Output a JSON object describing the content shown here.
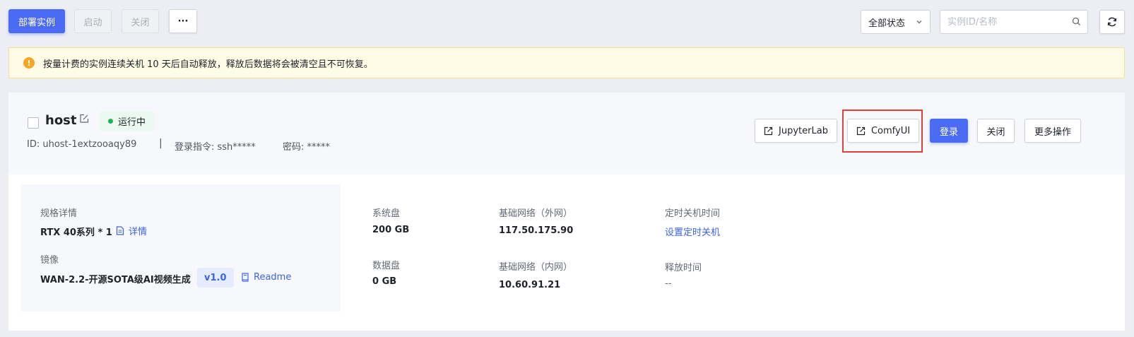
{
  "toolbar": {
    "deploy_label": "部署实例",
    "start_label": "启动",
    "close_label": "关闭",
    "more_label": "···",
    "status_filter": "全部状态",
    "search_placeholder": "实例ID/名称"
  },
  "notice": {
    "text": "按量计费的实例连续关机 10 天后自动释放，释放后数据将会被清空且不可恢复。"
  },
  "instance": {
    "name": "host",
    "status": "运行中",
    "id_text": "ID: uhost-1extzooaqy89",
    "separator": "|",
    "login_cmd": "登录指令: ssh*****",
    "password": "密码: *****",
    "actions": {
      "jupyter": "JupyterLab",
      "comfy": "ComfyUI",
      "login": "登录",
      "close": "关闭",
      "more": "更多操作"
    },
    "spec": {
      "spec_label": "规格详情",
      "spec_value": "RTX 40系列 * 1",
      "detail_link": "详情",
      "image_label": "镜像",
      "image_value": "WAN-2.2-开源SOTA级AI视频生成",
      "image_version": "v1.0",
      "readme_link": "Readme"
    },
    "disks": {
      "system_label": "系统盘",
      "system_value": "200 GB",
      "data_label": "数据盘",
      "data_value": "0 GB"
    },
    "network": {
      "public_label": "基础网络（外网）",
      "public_value": "117.50.175.90",
      "private_label": "基础网络（内网）",
      "private_value": "10.60.91.21"
    },
    "schedule": {
      "shutdown_label": "定时关机时间",
      "shutdown_link": "设置定时关机",
      "release_label": "释放时间",
      "release_value": "--"
    }
  },
  "colors": {
    "primary": "#4b6bf5",
    "link": "#3a63e8",
    "running": "#1fb35a",
    "warning": "#f5a623",
    "highlight": "#e0413c"
  }
}
